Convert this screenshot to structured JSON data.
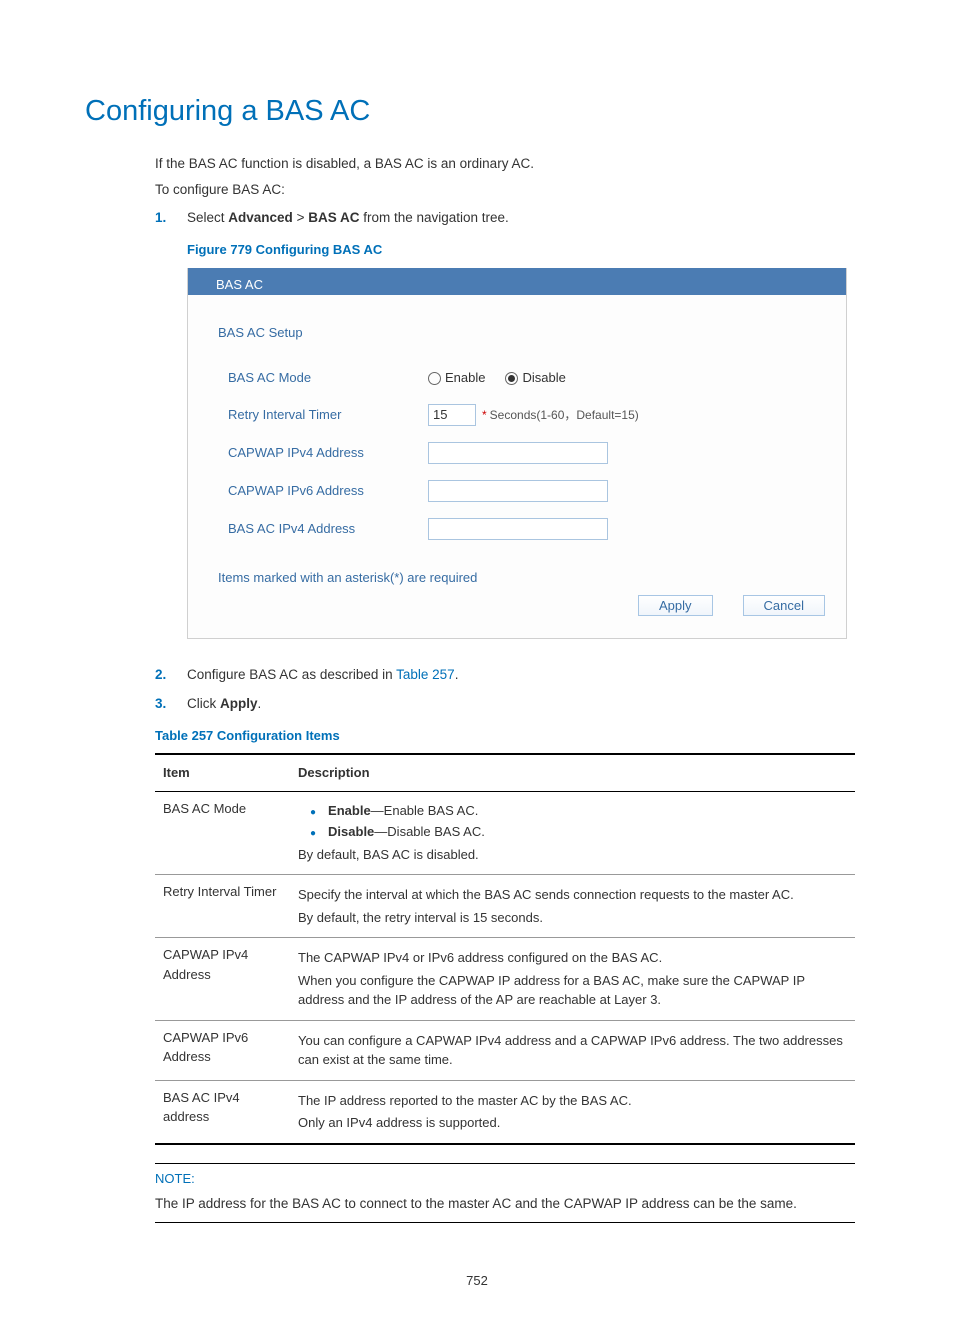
{
  "heading": "Configuring a BAS AC",
  "intro": {
    "line1": "If the BAS AC function is disabled, a BAS AC is an ordinary AC.",
    "line2": "To configure BAS AC:"
  },
  "steps": {
    "s1_num": "1.",
    "s1_pre": "Select ",
    "s1_b1": "Advanced",
    "s1_mid": " > ",
    "s1_b2": "BAS AC",
    "s1_post": " from the navigation tree.",
    "s2_num": "2.",
    "s2_text": "Configure BAS AC as described in ",
    "s2_link": "Table 257",
    "s2_post": ".",
    "s3_num": "3.",
    "s3_text": "Click ",
    "s3_bold": "Apply",
    "s3_post": "."
  },
  "figure": {
    "caption": "Figure 779 Configuring BAS AC",
    "tab": "BAS AC",
    "section": "BAS AC Setup",
    "rows": {
      "mode_label": "BAS AC Mode",
      "mode_enable": "Enable",
      "mode_disable": "Disable",
      "retry_label": "Retry Interval Timer",
      "retry_value": "15",
      "retry_hint": "Seconds(1-60，Default=15)",
      "capwap4_label": "CAPWAP IPv4 Address",
      "capwap6_label": "CAPWAP IPv6 Address",
      "bas4_label": "BAS AC IPv4 Address"
    },
    "required_note": "Items marked with an asterisk(*) are required",
    "btn_apply": "Apply",
    "btn_cancel": "Cancel"
  },
  "table": {
    "caption": "Table 257 Configuration Items",
    "col_item": "Item",
    "col_desc": "Description",
    "rows": {
      "mode": {
        "item": "BAS AC Mode",
        "enable_b": "Enable",
        "enable_t": "—Enable BAS AC.",
        "disable_b": "Disable",
        "disable_t": "—Disable BAS AC.",
        "default": "By default, BAS AC is disabled."
      },
      "retry": {
        "item": "Retry Interval Timer",
        "l1": "Specify the interval at which the BAS AC sends connection requests to the master AC.",
        "l2": "By default, the retry interval is 15 seconds."
      },
      "cap4": {
        "item": "CAPWAP IPv4 Address",
        "l1": "The CAPWAP IPv4 or IPv6 address configured on the BAS AC.",
        "l2": "When you configure the CAPWAP IP address for a BAS AC, make sure the CAPWAP IP address and the IP address of the AP are reachable at Layer 3."
      },
      "cap6": {
        "item": "CAPWAP IPv6 Address",
        "l1": "You can configure a CAPWAP IPv4 address and a CAPWAP IPv6 address. The two addresses can exist at the same time."
      },
      "bas4": {
        "item": "BAS AC IPv4 address",
        "l1": "The IP address reported to the master AC by the BAS AC.",
        "l2": "Only an IPv4 address is supported."
      }
    }
  },
  "note": {
    "label": "NOTE:",
    "text": "The IP address for the BAS AC to connect to the master AC and the CAPWAP IP address can be the same."
  },
  "page_number": "752"
}
